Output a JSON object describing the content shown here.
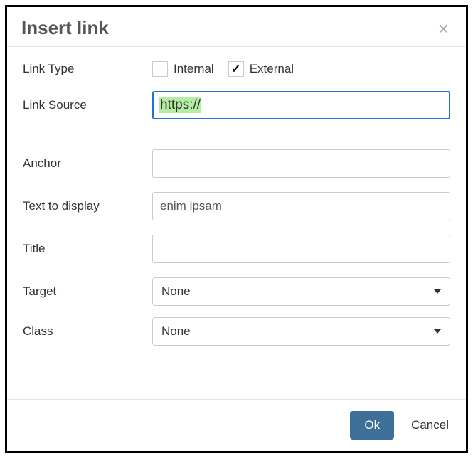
{
  "dialog": {
    "title": "Insert link",
    "fields": {
      "linkType": {
        "label": "Link Type",
        "options": {
          "internal": {
            "label": "Internal",
            "checked": false
          },
          "external": {
            "label": "External",
            "checked": true
          }
        }
      },
      "linkSource": {
        "label": "Link Source",
        "value": "https://"
      },
      "anchor": {
        "label": "Anchor",
        "value": ""
      },
      "textToDisplay": {
        "label": "Text to display",
        "value": "enim ipsam"
      },
      "title": {
        "label": "Title",
        "value": ""
      },
      "target": {
        "label": "Target",
        "value": "None"
      },
      "class": {
        "label": "Class",
        "value": "None"
      }
    },
    "buttons": {
      "ok": "Ok",
      "cancel": "Cancel"
    }
  }
}
